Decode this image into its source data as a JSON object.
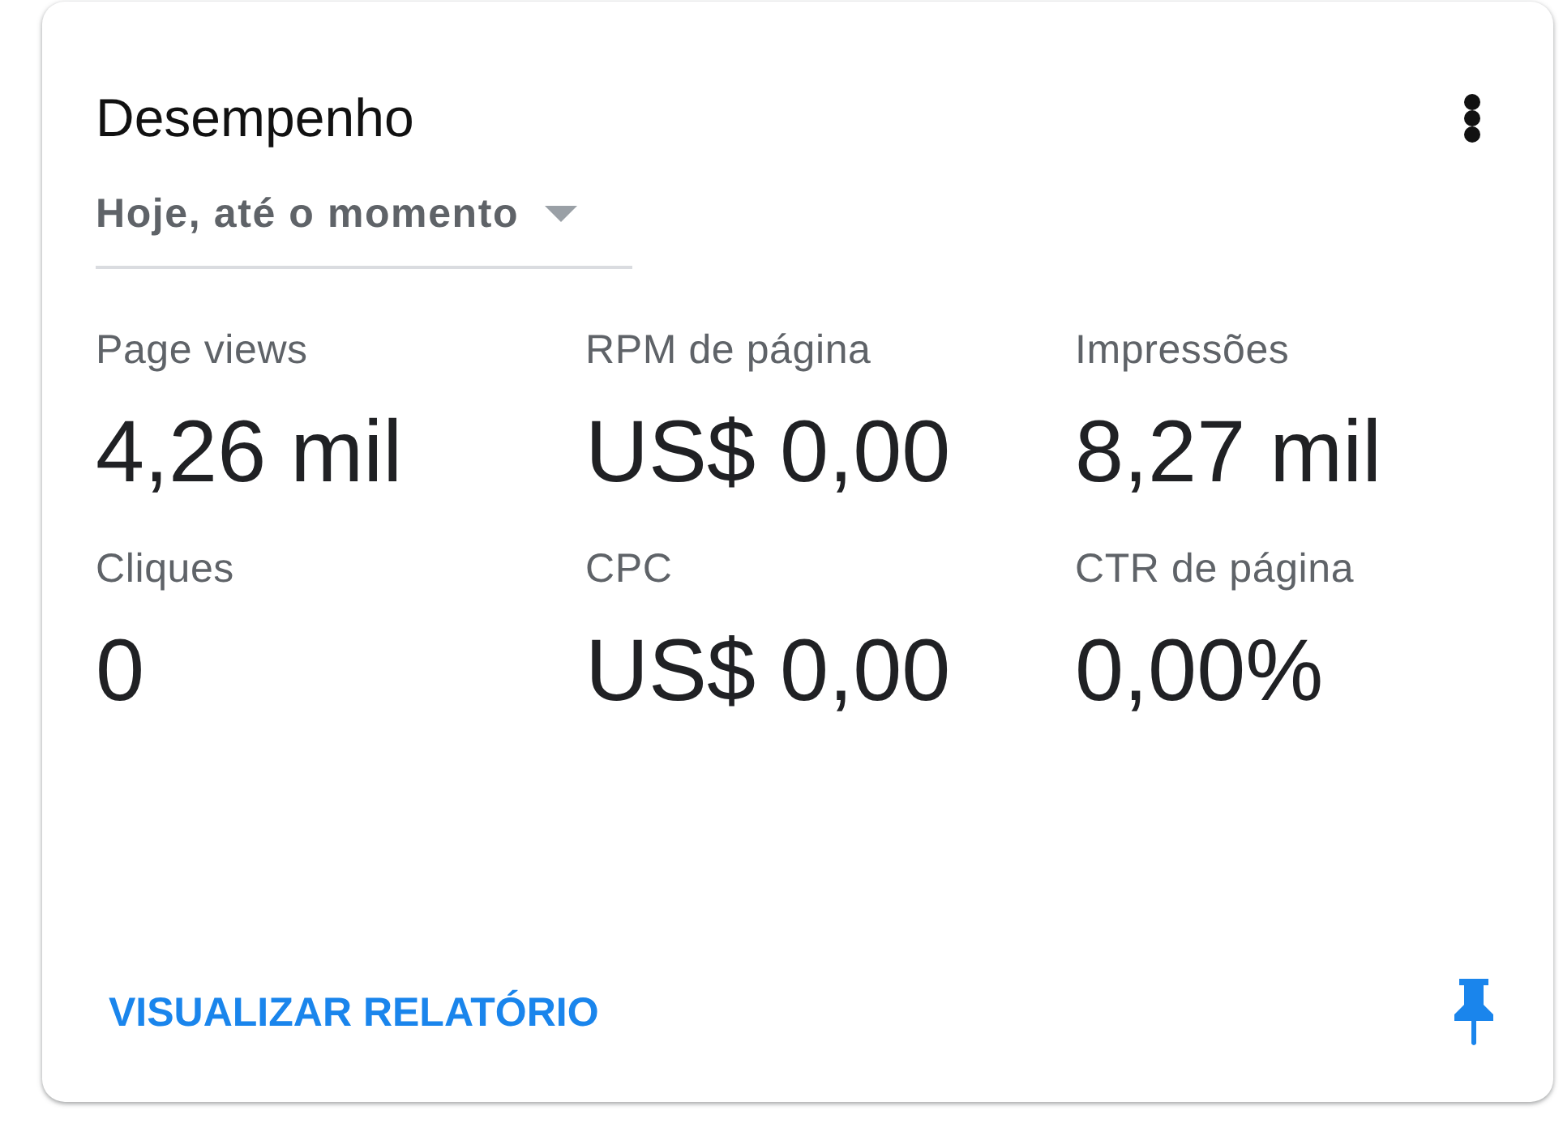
{
  "card": {
    "title": "Desempenho",
    "date_range": "Hoje, até o momento",
    "metrics": [
      {
        "label": "Page views",
        "value": "4,26 mil"
      },
      {
        "label": "RPM de página",
        "value": "US$ 0,00"
      },
      {
        "label": "Impressões",
        "value": "8,27 mil"
      },
      {
        "label": "Cliques",
        "value": "0"
      },
      {
        "label": "CPC",
        "value": "US$ 0,00"
      },
      {
        "label": "CTR de página",
        "value": "0,00%"
      }
    ],
    "report_link": "VISUALIZAR RELATÓRIO"
  }
}
